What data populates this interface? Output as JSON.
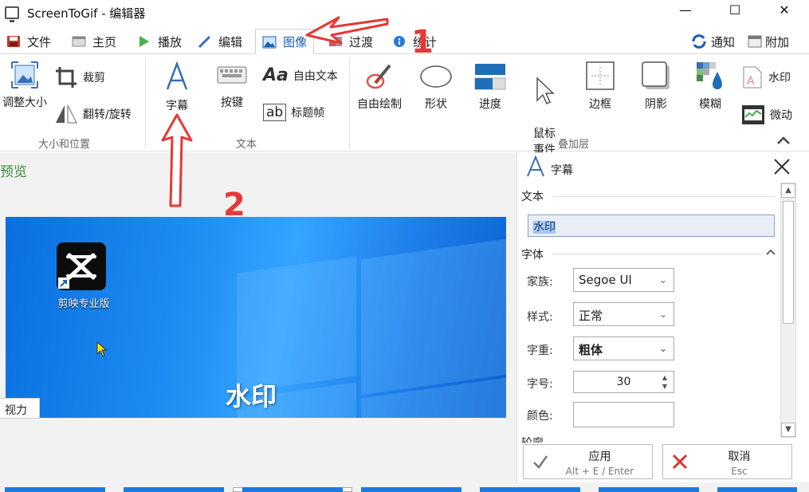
{
  "window": {
    "title": "ScreenToGif - 编辑器",
    "minimize": "—",
    "maximize": "☐",
    "close": "✕"
  },
  "tabs": [
    {
      "label": "文件",
      "icon": "save-icon"
    },
    {
      "label": "主页",
      "icon": "home-icon"
    },
    {
      "label": "播放",
      "icon": "play-icon"
    },
    {
      "label": "编辑",
      "icon": "pencil-icon"
    },
    {
      "label": "图像",
      "icon": "image-icon",
      "active": true
    },
    {
      "label": "过渡",
      "icon": "transition-icon"
    },
    {
      "label": "统计",
      "icon": "info-icon"
    }
  ],
  "right_tabs": {
    "notify": "通知",
    "attach": "附加"
  },
  "ribbon": {
    "size_group": {
      "resize": "调整大小",
      "crop": "裁剪",
      "flip": "翻转/旋转",
      "label": "大小和位置"
    },
    "text_group": {
      "caption": "字幕",
      "keys": "按键",
      "free_text": "自由文本",
      "title_frame": "标题帧",
      "label": "文本"
    },
    "overlay_group": {
      "free_draw": "自由绘制",
      "shape": "形状",
      "progress": "进度",
      "mouse_events": "鼠标\n事件",
      "border": "边框",
      "shadow": "阴影",
      "blur": "模糊",
      "watermark": "水印",
      "motion": "微动",
      "label": "叠加层"
    }
  },
  "preview": {
    "label": "预览",
    "desktop_icon_label": "剪映专业版",
    "watermark_text": "水印",
    "vision_tab": "视力"
  },
  "panel": {
    "title": "字幕",
    "text_section": "文本",
    "text_value": "水印",
    "font_section": "字体",
    "family_label": "家族:",
    "family_value": "Segoe UI",
    "style_label": "样式:",
    "style_value": "正常",
    "weight_label": "字重:",
    "weight_value": "粗体",
    "size_label": "字号:",
    "size_value": "30",
    "color_label": "颜色:",
    "next_section": "轮廓"
  },
  "actions": {
    "apply": "应用",
    "apply_shortcut": "Alt + E / Enter",
    "cancel": "取消",
    "cancel_shortcut": "Esc"
  },
  "annotations": {
    "one": "1",
    "two": "2"
  }
}
